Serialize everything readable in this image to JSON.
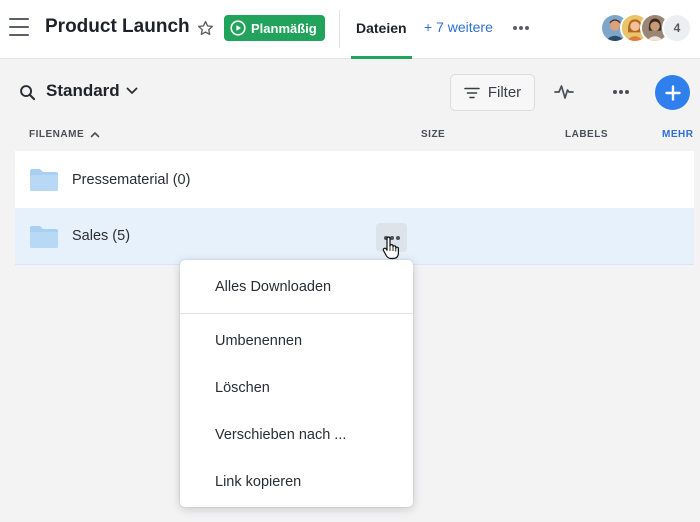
{
  "header": {
    "title": "Product Launch",
    "status_label": "Planmäßig",
    "active_tab": "Dateien",
    "more_tabs_label": "+ 7 weitere",
    "member_count": "4",
    "accent_color": "#21a35b",
    "link_color": "#2f6fd6"
  },
  "toolbar": {
    "view_label": "Standard",
    "filter_label": "Filter"
  },
  "table": {
    "columns": {
      "filename": "FILENAME",
      "size": "SIZE",
      "labels": "LABELS",
      "more": "MEHR"
    },
    "rows": [
      {
        "label": "Pressematerial (0)",
        "icon": "folder-icon"
      },
      {
        "label": "Sales (5)",
        "icon": "folder-icon",
        "highlighted": true
      }
    ]
  },
  "context_menu": {
    "items": [
      "Alles Downloaden",
      "Umbenennen",
      "Löschen",
      "Verschieben nach ...",
      "Link kopieren"
    ]
  }
}
